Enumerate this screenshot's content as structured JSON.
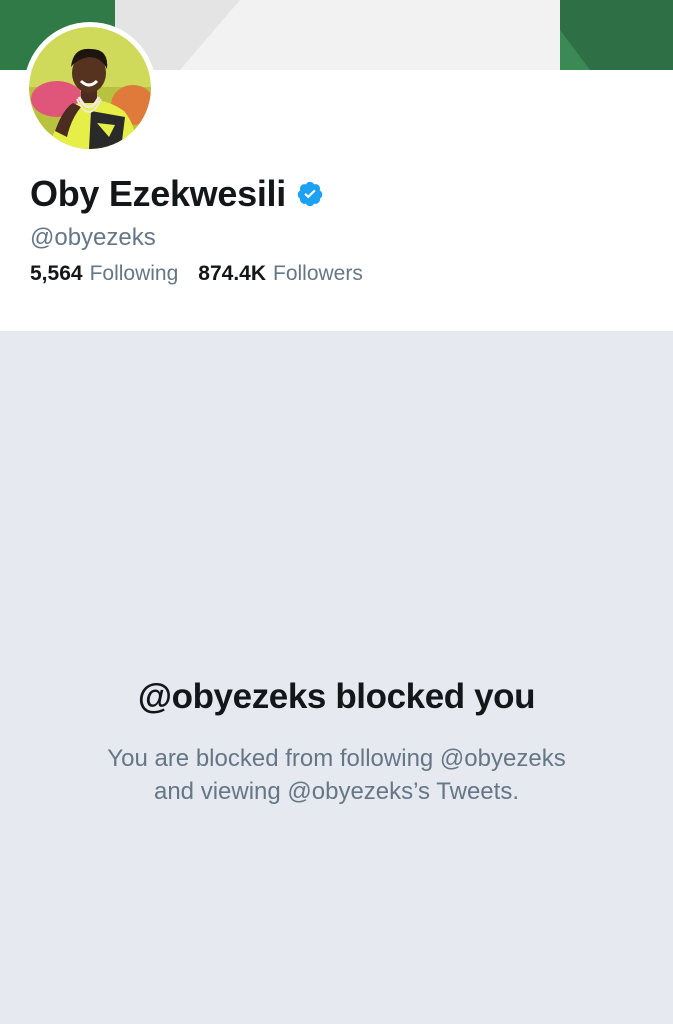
{
  "banner": {
    "colors": {
      "green": "#2f7a47",
      "white": "#ffffff",
      "light": "#ebebeb"
    }
  },
  "profile": {
    "display_name": "Oby Ezekwesili",
    "handle": "@obyezeks",
    "verified": true,
    "stats": {
      "following_count": "5,564",
      "following_label": "Following",
      "followers_count": "874.4K",
      "followers_label": "Followers"
    }
  },
  "blocked": {
    "title": "@obyezeks blocked you",
    "message_line1": "You are blocked from following @obyezeks",
    "message_line2": "and viewing @obyezeks’s Tweets."
  },
  "colors": {
    "verified_blue": "#1da1f2",
    "text_primary": "#14171a",
    "text_secondary": "#657786",
    "background": "#e6e9ef"
  }
}
